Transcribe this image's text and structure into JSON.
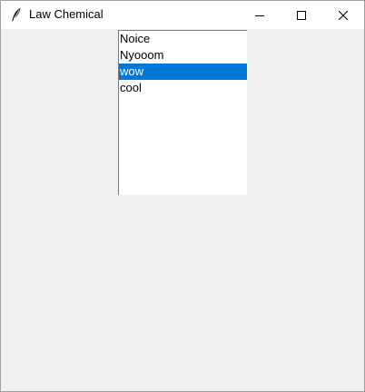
{
  "window": {
    "title": "Law Chemical",
    "app_icon": "feather-icon",
    "controls": {
      "minimize_icon": "minimize-icon",
      "maximize_icon": "maximize-icon",
      "close_icon": "close-icon"
    }
  },
  "listbox": {
    "items": [
      "Noice",
      "Nyooom",
      "wow",
      "cool"
    ],
    "selected_index": 2,
    "selected_label": "wow"
  },
  "colors": {
    "selection_background": "#0078d7",
    "selection_text": "#ffffff",
    "client_background": "#f0f0f0",
    "titlebar_background": "#ffffff"
  }
}
